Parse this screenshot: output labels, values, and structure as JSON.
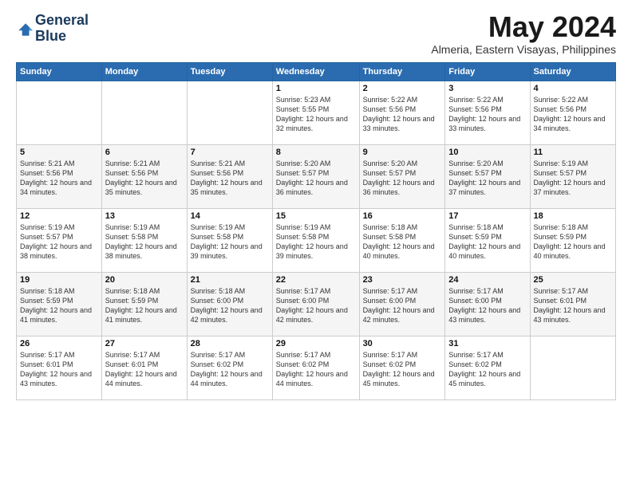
{
  "logo": {
    "line1": "General",
    "line2": "Blue"
  },
  "title": "May 2024",
  "location": "Almeria, Eastern Visayas, Philippines",
  "days_header": [
    "Sunday",
    "Monday",
    "Tuesday",
    "Wednesday",
    "Thursday",
    "Friday",
    "Saturday"
  ],
  "weeks": [
    [
      {
        "num": "",
        "sunrise": "",
        "sunset": "",
        "daylight": ""
      },
      {
        "num": "",
        "sunrise": "",
        "sunset": "",
        "daylight": ""
      },
      {
        "num": "",
        "sunrise": "",
        "sunset": "",
        "daylight": ""
      },
      {
        "num": "1",
        "sunrise": "Sunrise: 5:23 AM",
        "sunset": "Sunset: 5:55 PM",
        "daylight": "Daylight: 12 hours and 32 minutes."
      },
      {
        "num": "2",
        "sunrise": "Sunrise: 5:22 AM",
        "sunset": "Sunset: 5:56 PM",
        "daylight": "Daylight: 12 hours and 33 minutes."
      },
      {
        "num": "3",
        "sunrise": "Sunrise: 5:22 AM",
        "sunset": "Sunset: 5:56 PM",
        "daylight": "Daylight: 12 hours and 33 minutes."
      },
      {
        "num": "4",
        "sunrise": "Sunrise: 5:22 AM",
        "sunset": "Sunset: 5:56 PM",
        "daylight": "Daylight: 12 hours and 34 minutes."
      }
    ],
    [
      {
        "num": "5",
        "sunrise": "Sunrise: 5:21 AM",
        "sunset": "Sunset: 5:56 PM",
        "daylight": "Daylight: 12 hours and 34 minutes."
      },
      {
        "num": "6",
        "sunrise": "Sunrise: 5:21 AM",
        "sunset": "Sunset: 5:56 PM",
        "daylight": "Daylight: 12 hours and 35 minutes."
      },
      {
        "num": "7",
        "sunrise": "Sunrise: 5:21 AM",
        "sunset": "Sunset: 5:56 PM",
        "daylight": "Daylight: 12 hours and 35 minutes."
      },
      {
        "num": "8",
        "sunrise": "Sunrise: 5:20 AM",
        "sunset": "Sunset: 5:57 PM",
        "daylight": "Daylight: 12 hours and 36 minutes."
      },
      {
        "num": "9",
        "sunrise": "Sunrise: 5:20 AM",
        "sunset": "Sunset: 5:57 PM",
        "daylight": "Daylight: 12 hours and 36 minutes."
      },
      {
        "num": "10",
        "sunrise": "Sunrise: 5:20 AM",
        "sunset": "Sunset: 5:57 PM",
        "daylight": "Daylight: 12 hours and 37 minutes."
      },
      {
        "num": "11",
        "sunrise": "Sunrise: 5:19 AM",
        "sunset": "Sunset: 5:57 PM",
        "daylight": "Daylight: 12 hours and 37 minutes."
      }
    ],
    [
      {
        "num": "12",
        "sunrise": "Sunrise: 5:19 AM",
        "sunset": "Sunset: 5:57 PM",
        "daylight": "Daylight: 12 hours and 38 minutes."
      },
      {
        "num": "13",
        "sunrise": "Sunrise: 5:19 AM",
        "sunset": "Sunset: 5:58 PM",
        "daylight": "Daylight: 12 hours and 38 minutes."
      },
      {
        "num": "14",
        "sunrise": "Sunrise: 5:19 AM",
        "sunset": "Sunset: 5:58 PM",
        "daylight": "Daylight: 12 hours and 39 minutes."
      },
      {
        "num": "15",
        "sunrise": "Sunrise: 5:19 AM",
        "sunset": "Sunset: 5:58 PM",
        "daylight": "Daylight: 12 hours and 39 minutes."
      },
      {
        "num": "16",
        "sunrise": "Sunrise: 5:18 AM",
        "sunset": "Sunset: 5:58 PM",
        "daylight": "Daylight: 12 hours and 40 minutes."
      },
      {
        "num": "17",
        "sunrise": "Sunrise: 5:18 AM",
        "sunset": "Sunset: 5:59 PM",
        "daylight": "Daylight: 12 hours and 40 minutes."
      },
      {
        "num": "18",
        "sunrise": "Sunrise: 5:18 AM",
        "sunset": "Sunset: 5:59 PM",
        "daylight": "Daylight: 12 hours and 40 minutes."
      }
    ],
    [
      {
        "num": "19",
        "sunrise": "Sunrise: 5:18 AM",
        "sunset": "Sunset: 5:59 PM",
        "daylight": "Daylight: 12 hours and 41 minutes."
      },
      {
        "num": "20",
        "sunrise": "Sunrise: 5:18 AM",
        "sunset": "Sunset: 5:59 PM",
        "daylight": "Daylight: 12 hours and 41 minutes."
      },
      {
        "num": "21",
        "sunrise": "Sunrise: 5:18 AM",
        "sunset": "Sunset: 6:00 PM",
        "daylight": "Daylight: 12 hours and 42 minutes."
      },
      {
        "num": "22",
        "sunrise": "Sunrise: 5:17 AM",
        "sunset": "Sunset: 6:00 PM",
        "daylight": "Daylight: 12 hours and 42 minutes."
      },
      {
        "num": "23",
        "sunrise": "Sunrise: 5:17 AM",
        "sunset": "Sunset: 6:00 PM",
        "daylight": "Daylight: 12 hours and 42 minutes."
      },
      {
        "num": "24",
        "sunrise": "Sunrise: 5:17 AM",
        "sunset": "Sunset: 6:00 PM",
        "daylight": "Daylight: 12 hours and 43 minutes."
      },
      {
        "num": "25",
        "sunrise": "Sunrise: 5:17 AM",
        "sunset": "Sunset: 6:01 PM",
        "daylight": "Daylight: 12 hours and 43 minutes."
      }
    ],
    [
      {
        "num": "26",
        "sunrise": "Sunrise: 5:17 AM",
        "sunset": "Sunset: 6:01 PM",
        "daylight": "Daylight: 12 hours and 43 minutes."
      },
      {
        "num": "27",
        "sunrise": "Sunrise: 5:17 AM",
        "sunset": "Sunset: 6:01 PM",
        "daylight": "Daylight: 12 hours and 44 minutes."
      },
      {
        "num": "28",
        "sunrise": "Sunrise: 5:17 AM",
        "sunset": "Sunset: 6:02 PM",
        "daylight": "Daylight: 12 hours and 44 minutes."
      },
      {
        "num": "29",
        "sunrise": "Sunrise: 5:17 AM",
        "sunset": "Sunset: 6:02 PM",
        "daylight": "Daylight: 12 hours and 44 minutes."
      },
      {
        "num": "30",
        "sunrise": "Sunrise: 5:17 AM",
        "sunset": "Sunset: 6:02 PM",
        "daylight": "Daylight: 12 hours and 45 minutes."
      },
      {
        "num": "31",
        "sunrise": "Sunrise: 5:17 AM",
        "sunset": "Sunset: 6:02 PM",
        "daylight": "Daylight: 12 hours and 45 minutes."
      },
      {
        "num": "",
        "sunrise": "",
        "sunset": "",
        "daylight": ""
      }
    ]
  ]
}
